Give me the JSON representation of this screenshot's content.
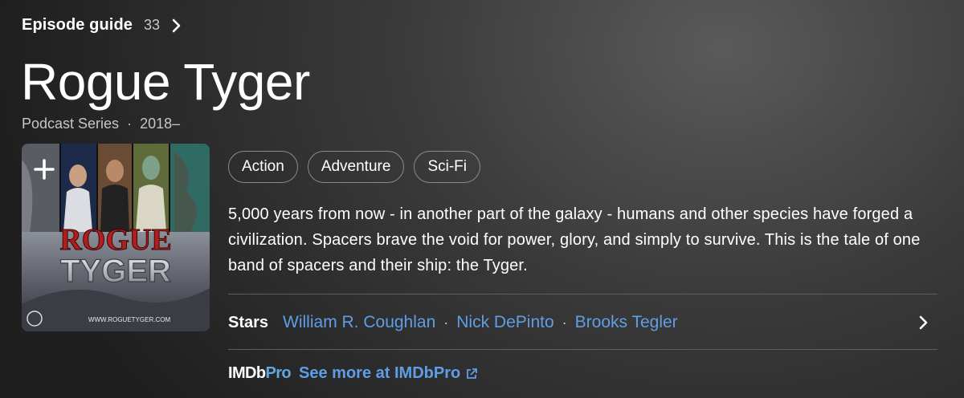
{
  "episode_guide": {
    "label": "Episode guide",
    "count": "33"
  },
  "title": "Rogue Tyger",
  "meta": {
    "type": "Podcast Series",
    "separator": "·",
    "years": "2018–"
  },
  "poster": {
    "logo_line1": "ROGUE",
    "logo_line2": "TYGER",
    "url": "WWW.ROGUETYGER.COM"
  },
  "genres": [
    "Action",
    "Adventure",
    "Sci-Fi"
  ],
  "plot": "5,000 years from now - in another part of the galaxy - humans and other species have forged a civilization. Spacers brave the void for power, glory, and simply to survive. This is the tale of one band of spacers and their ship: the Tyger.",
  "stars": {
    "label": "Stars",
    "names": [
      "William R. Coughlan",
      "Nick DePinto",
      "Brooks Tegler"
    ],
    "separator": "·"
  },
  "imdbpro": {
    "logo_imdb": "IMDb",
    "logo_pro": "Pro",
    "link": "See more at IMDbPro"
  },
  "colors": {
    "link": "#5f9ee6",
    "chip_border": "#8a8a8a",
    "divider": "#5e5e5e"
  }
}
